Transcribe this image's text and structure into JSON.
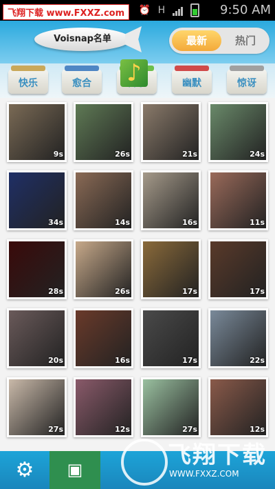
{
  "watermark_top": "飞翔下载 www.FXXZ.com",
  "status": {
    "time": "9:50 AM",
    "network": "H"
  },
  "header": {
    "blimp_label": "Voisnap名单",
    "tabs": [
      {
        "label": "最新",
        "active": true
      },
      {
        "label": "热门",
        "active": false
      }
    ]
  },
  "categories": [
    {
      "label": "快乐",
      "cap": "#c9a85a"
    },
    {
      "label": "愈合",
      "cap": "#4f86c4"
    },
    {
      "label": "音乐",
      "cap": "#6cbf4a"
    },
    {
      "label": "幽默",
      "cap": "#d04a4a"
    },
    {
      "label": "惊讶",
      "cap": "#a0a0a0"
    }
  ],
  "videos": [
    {
      "duration": "9s",
      "color": "#7a6a55"
    },
    {
      "duration": "26s",
      "color": "#5f7a55"
    },
    {
      "duration": "21s",
      "color": "#8a7a6a"
    },
    {
      "duration": "24s",
      "color": "#6a8a6a"
    },
    {
      "duration": "34s",
      "color": "#1f2f66"
    },
    {
      "duration": "14s",
      "color": "#8a6a55"
    },
    {
      "duration": "16s",
      "color": "#a59a8a"
    },
    {
      "duration": "11s",
      "color": "#9a6a5a"
    },
    {
      "duration": "28s",
      "color": "#3a0a0a"
    },
    {
      "duration": "26s",
      "color": "#c7a98a"
    },
    {
      "duration": "17s",
      "color": "#8a6a3a"
    },
    {
      "duration": "17s",
      "color": "#5a3a2a"
    },
    {
      "duration": "20s",
      "color": "#6a5a5a"
    },
    {
      "duration": "16s",
      "color": "#6a3a2a"
    },
    {
      "duration": "17s",
      "color": "#4a4a4a"
    },
    {
      "duration": "22s",
      "color": "#7a8a9a"
    },
    {
      "duration": "27s",
      "color": "#c9b9a9"
    },
    {
      "duration": "12s",
      "color": "#8a5a6a"
    },
    {
      "duration": "27s",
      "color": "#9ac0a0"
    },
    {
      "duration": "12s",
      "color": "#8a5a4a"
    }
  ],
  "watermark_bottom": {
    "title": "飞翔下载",
    "url": "WWW.FXXZ.COM"
  },
  "bottombar": {
    "settings_icon": "gear-icon",
    "gallery_icon": "gallery-icon"
  }
}
